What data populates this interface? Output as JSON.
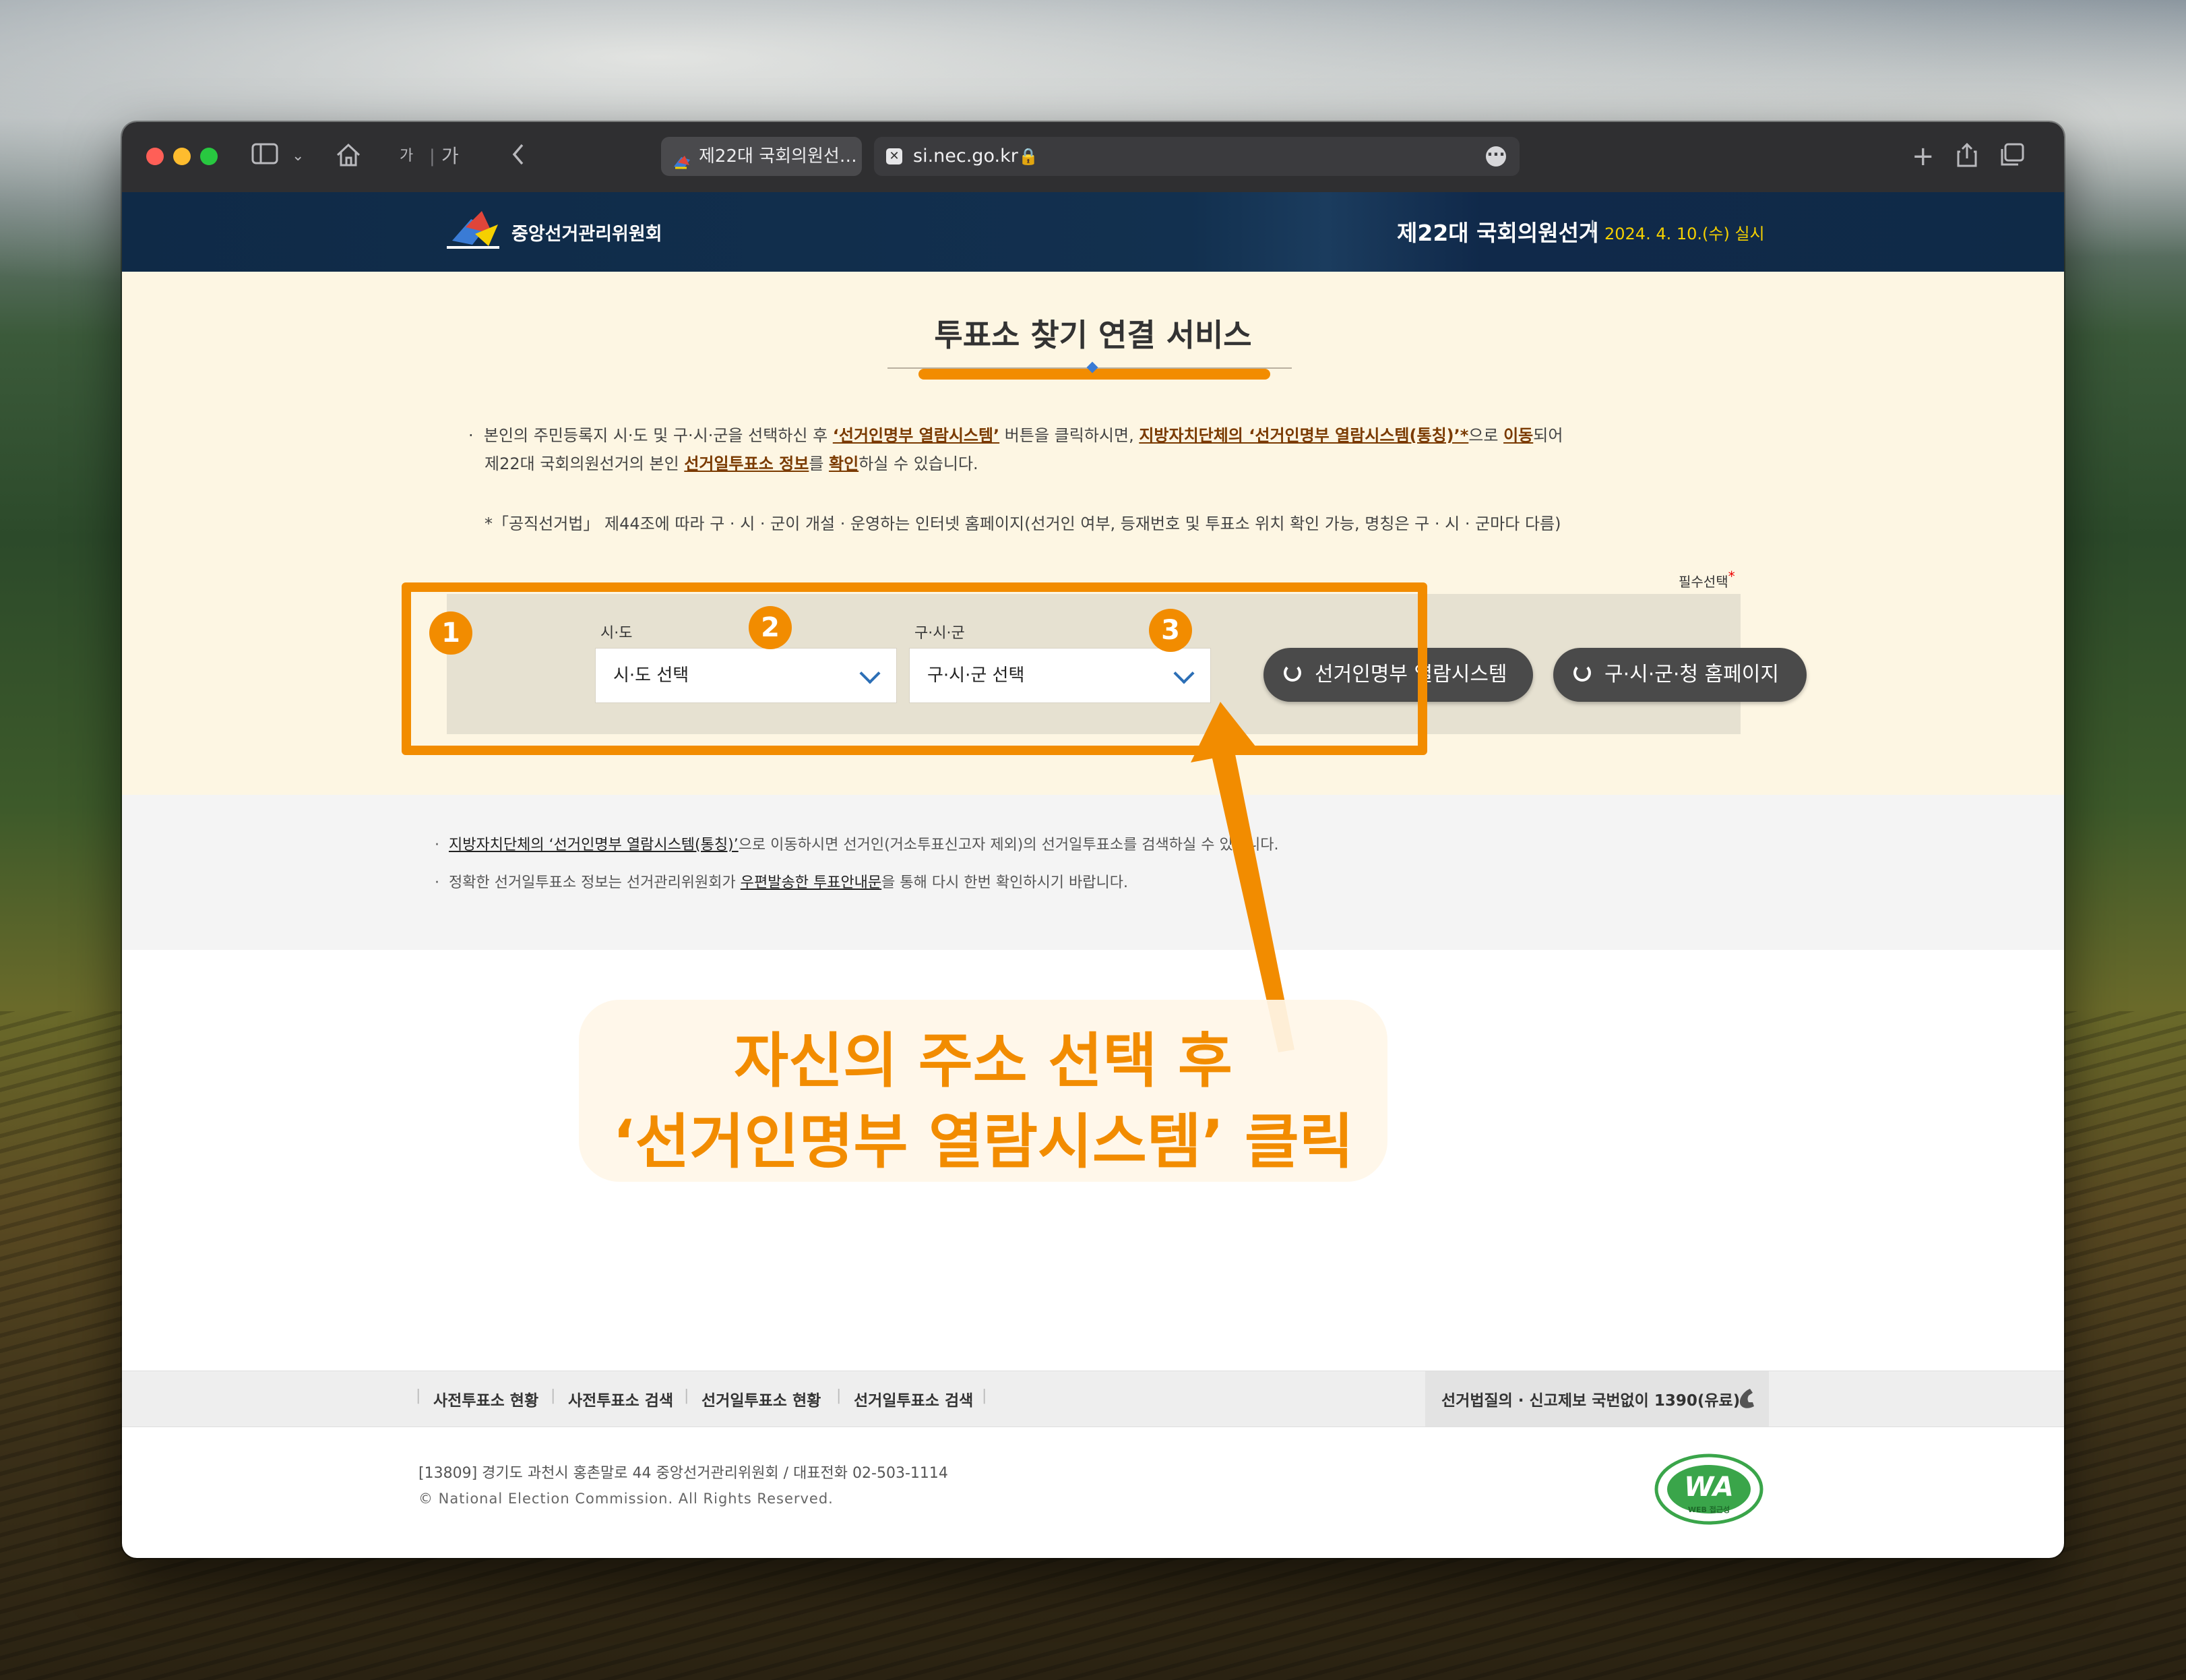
{
  "browser": {
    "tab_title": "제22대 국회의원선…",
    "url": "si.nec.go.kr",
    "text_size_small": "가",
    "text_size_large": "가"
  },
  "header": {
    "org_name": "중앙선거관리위원회",
    "election_name": "제22대 국회의원선거",
    "separator": "|",
    "election_date": "2024. 4. 10.(수) 실시"
  },
  "main": {
    "title": "투표소 찾기 연결 서비스",
    "desc": {
      "p1_a": "본인의 주민등록지 시·도 및 구·시·군을 선택하신 후 ",
      "p1_b": "‘선거인명부 열람시스템’",
      "p1_c": " 버튼을 클릭하시면, ",
      "p1_d": "지방자치단체의 ‘선거인명부 열람시스템(통칭)’*",
      "p1_e": "으로 ",
      "p1_f": "이동",
      "p1_g": "되어",
      "p2_a": "제22대 국회의원선거의 본인 ",
      "p2_b": "선거일투표소 정보",
      "p2_c": "를 ",
      "p2_d": "확인",
      "p2_e": "하실 수 있습니다."
    },
    "note": "*「공직선거법」 제44조에 따라 구 · 시 · 군이 개설 · 운영하는 인터넷 홈페이지(선거인 여부, 등재번호 및 투표소 위치 확인 가능, 명칭은 구 · 시 · 군마다 다름)",
    "required_label": "필수선택",
    "sido_label": "시·도",
    "sido_value": "시·도 선택",
    "sigungu_label": "구·시·군",
    "sigungu_value": "구·시·군 선택",
    "btn_register": "선거인명부 열람시스템",
    "btn_homepage": "구·시·군·청 홈페이지"
  },
  "info": {
    "line1_link": "지방자치단체의 ‘선거인명부 열람시스템(통칭)’",
    "line1_rest": "으로 이동하시면 선거인(거소투표신고자 제외)의 선거일투표소를 검색하실 수 있습니다.",
    "line2_a": "정확한 선거일투표소 정보는 선거관리위원회가 ",
    "line2_link": "우편발송한 투표안내문",
    "line2_b": "을 통해 다시 한번 확인하시기 바랍니다."
  },
  "footer": {
    "nav": [
      "사전투표소 현황",
      "사전투표소 검색",
      "선거일투표소 현황",
      "선거일투표소 검색"
    ],
    "hotline": "선거법질의 · 신고제보 국번없이 1390(유료)",
    "address": "[13809] 경기도 과천시 홍촌말로 44 중앙선거관리위원회  /  대표전화 02-503-1114",
    "copyright": "© National Election Commission. All Rights Reserved.",
    "wa_mark": "WA",
    "wa_sub": "WEB 접근성"
  },
  "annotation": {
    "badge1": "1",
    "badge2": "2",
    "badge3": "3",
    "line1": "자신의 주소 선택 후",
    "line2": "‘선거인명부 열람시스템’ 클릭"
  },
  "colors": {
    "accent_orange": "#f28c00",
    "header_navy": "#0f2a47",
    "date_yellow": "#f5d000",
    "main_bg": "#fdf6e3"
  }
}
